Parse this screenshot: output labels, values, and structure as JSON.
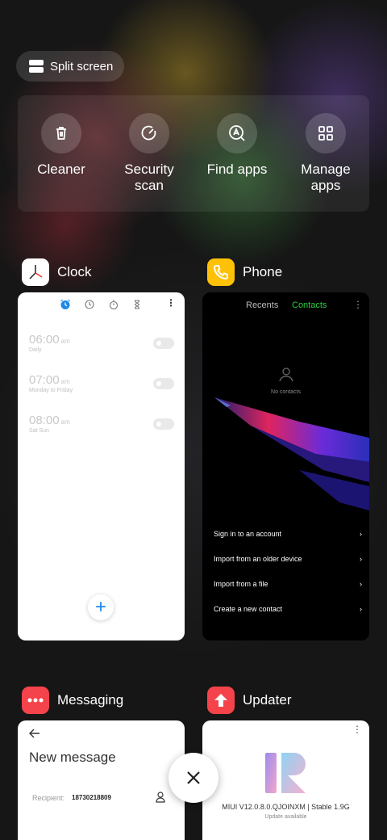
{
  "split_screen": {
    "label": "Split screen"
  },
  "quick_actions": [
    {
      "label": "Cleaner",
      "icon": "trash-icon"
    },
    {
      "label": "Security scan",
      "icon": "security-scan-icon"
    },
    {
      "label": "Find apps",
      "icon": "find-apps-icon"
    },
    {
      "label": "Manage apps",
      "icon": "grid-icon"
    }
  ],
  "apps": {
    "clock": {
      "name": "Clock",
      "alarms": [
        {
          "time": "06:00",
          "ampm": "am",
          "repeat": "Daily"
        },
        {
          "time": "07:00",
          "ampm": "am",
          "repeat": "Monday to Friday"
        },
        {
          "time": "08:00",
          "ampm": "am",
          "repeat": "Sat Sun"
        }
      ],
      "fab": "+"
    },
    "phone": {
      "name": "Phone",
      "tab_recents": "Recents",
      "tab_contacts": "Contacts",
      "empty_text": "No contacts",
      "menu": [
        "Sign in to an account",
        "Import from an older device",
        "Import from a file",
        "Create a new contact"
      ]
    },
    "messaging": {
      "name": "Messaging",
      "title": "New message",
      "recipient_label": "Recipient:",
      "recipient_value": "18730218809"
    },
    "updater": {
      "name": "Updater",
      "version": "MIUI V12.0.8.0.QJOINXM | Stable 1.9G",
      "status": "Update available"
    }
  },
  "colors": {
    "clock_accent": "#1e88e5",
    "contacts_accent": "#2ecc40",
    "phone_icon": "#ffc107",
    "messaging_icon": "#f4434a",
    "updater_icon": "#f4434a"
  }
}
